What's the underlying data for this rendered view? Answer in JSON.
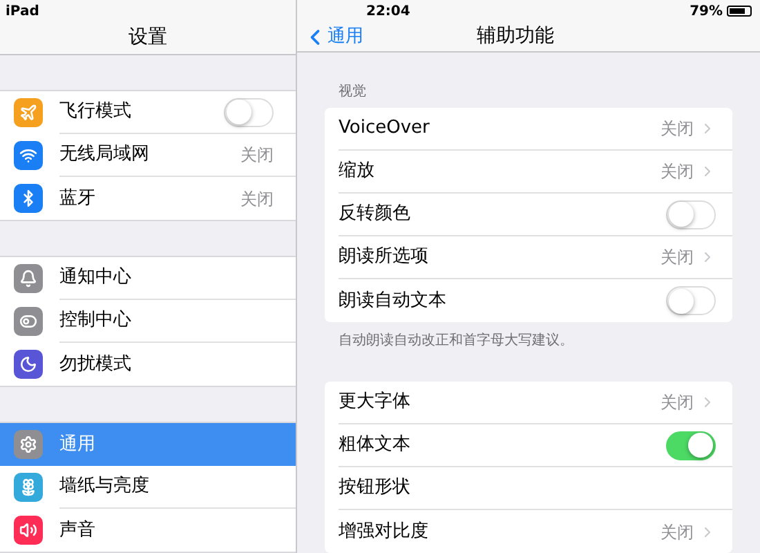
{
  "status_bar": {
    "device": "iPad",
    "time": "22:04",
    "battery": "79%"
  },
  "sidebar": {
    "title": "设置",
    "groups": [
      [
        {
          "label": "飞行模式",
          "color": "#f5a01e",
          "kind": "toggle",
          "on": false
        },
        {
          "label": "无线局域网",
          "color": "#1a7ff5",
          "kind": "value",
          "value": "关闭"
        },
        {
          "label": "蓝牙",
          "color": "#1a7ff5",
          "kind": "value",
          "value": "关闭"
        }
      ],
      [
        {
          "label": "通知中心",
          "color": "#8e8e93",
          "kind": "plain"
        },
        {
          "label": "控制中心",
          "color": "#8e8e93",
          "kind": "plain"
        },
        {
          "label": "勿扰模式",
          "color": "#5856d6",
          "kind": "plain"
        }
      ],
      [
        {
          "label": "通用",
          "color": "#8e8e93",
          "kind": "plain",
          "selected": true
        },
        {
          "label": "墙纸与亮度",
          "color": "#34aadc",
          "kind": "plain",
          "selected": false
        },
        {
          "label": "声音",
          "color": "#ff2d55",
          "kind": "plain",
          "selected": false
        }
      ]
    ]
  },
  "detail": {
    "back": "通用",
    "title": "辅助功能",
    "sections": [
      {
        "header": "视觉",
        "footer": "自动朗读自动改正和首字母大写建议。",
        "rows": [
          {
            "label": "VoiceOver",
            "kind": "value",
            "value": "关闭"
          },
          {
            "label": "缩放",
            "kind": "value",
            "value": "关闭"
          },
          {
            "label": "反转颜色",
            "kind": "toggle",
            "on": false
          },
          {
            "label": "朗读所选项",
            "kind": "value",
            "value": "关闭"
          },
          {
            "label": "朗读自动文本",
            "kind": "toggle",
            "on": false
          }
        ]
      },
      {
        "rows": [
          {
            "label": "更大字体",
            "kind": "value",
            "value": "关闭"
          },
          {
            "label": "粗体文本",
            "kind": "toggle",
            "on": true
          },
          {
            "label": "按钮形状",
            "kind": "plain"
          },
          {
            "label": "增强对比度",
            "kind": "value",
            "value": "关闭"
          }
        ]
      }
    ]
  }
}
